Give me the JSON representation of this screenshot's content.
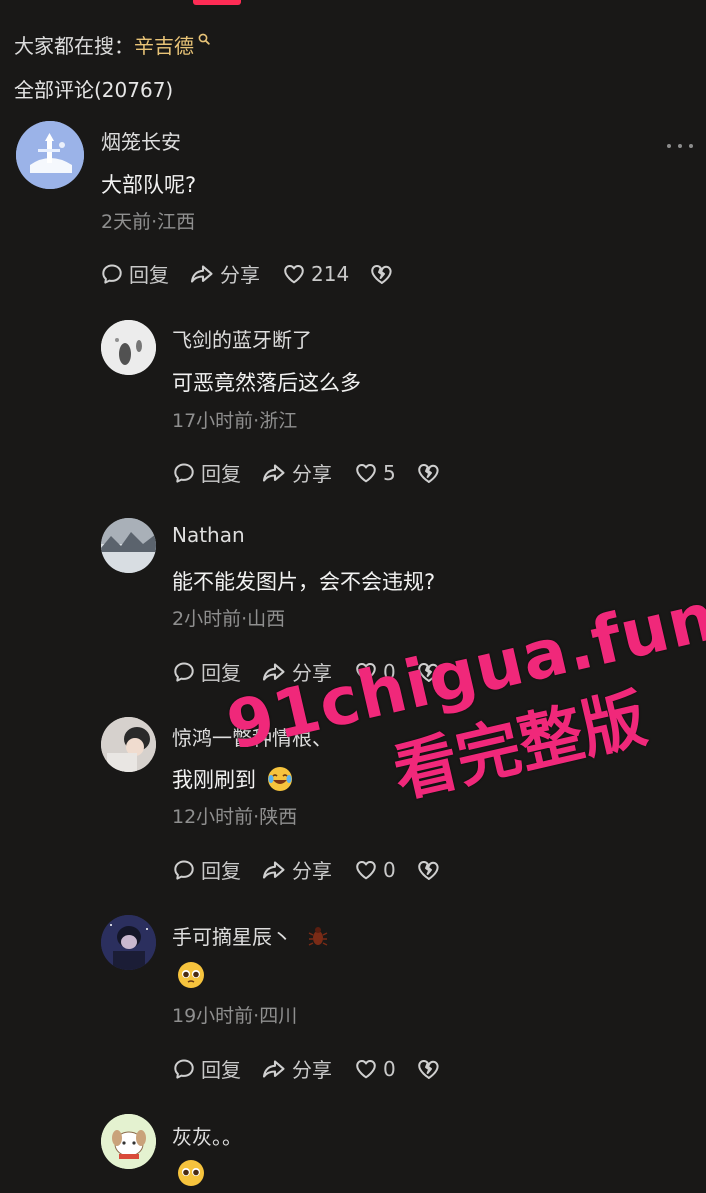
{
  "header": {
    "search_prefix": "大家都在搜：",
    "search_keyword": "辛吉德",
    "comment_count_label": "全部评论(20767)"
  },
  "comments": [
    {
      "username": "烟笼长安",
      "content": "大部队呢?",
      "meta": "2天前·江西",
      "reply_label": "回复",
      "share_label": "分享",
      "likes": "214"
    },
    {
      "username": "飞剑的蓝牙断了",
      "content": "可恶竟然落后这么多",
      "meta": "17小时前·浙江",
      "reply_label": "回复",
      "share_label": "分享",
      "likes": "5"
    },
    {
      "username": "Nathan",
      "content": "能不能发图片，会不会违规?",
      "meta": "2小时前·山西",
      "reply_label": "回复",
      "share_label": "分享",
      "likes": "0"
    },
    {
      "username": "惊鸿一瞥种情根、",
      "content": "我刚刷到",
      "meta": "12小时前·陕西",
      "reply_label": "回复",
      "share_label": "分享",
      "likes": "0"
    },
    {
      "username": "手可摘星辰丶",
      "content": "",
      "meta": "19小时前·四川",
      "reply_label": "回复",
      "share_label": "分享",
      "likes": "0"
    },
    {
      "username": "灰灰。。",
      "content": ""
    }
  ],
  "watermark": {
    "line1": "91chigua.fun",
    "line2": "看完整版"
  },
  "colors": {
    "background": "#191817",
    "accent": "#fe2c55",
    "keyword": "#e8c377",
    "watermark": "#f0287a"
  }
}
